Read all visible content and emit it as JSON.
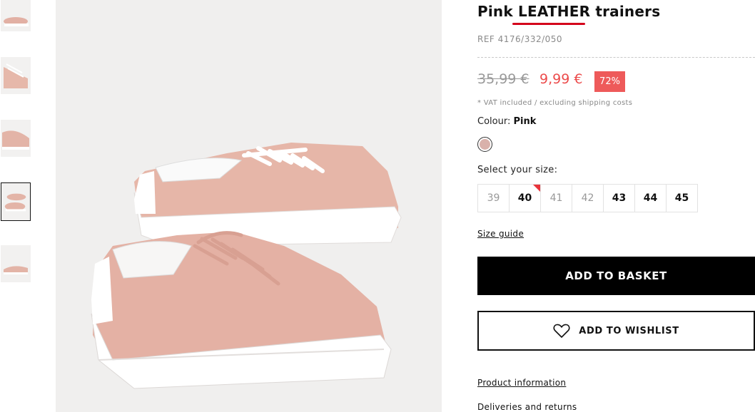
{
  "product": {
    "title": "Pink LEATHER trainers",
    "ref": "REF 4176/332/050",
    "old_price": "35,99 €",
    "new_price": "9,99 €",
    "discount": "72%",
    "vat_note": "* VAT included / excluding shipping costs",
    "colour_label": "Colour:",
    "colour_value": "Pink",
    "swatch_color": "#d9b1ab",
    "size_label": "Select your size:",
    "sizes": [
      {
        "label": "39",
        "available": false
      },
      {
        "label": "40",
        "available": true,
        "flagged": true
      },
      {
        "label": "41",
        "available": false
      },
      {
        "label": "42",
        "available": false
      },
      {
        "label": "43",
        "available": true
      },
      {
        "label": "44",
        "available": true
      },
      {
        "label": "45",
        "available": true
      }
    ],
    "size_guide": "Size guide",
    "add_to_basket": "ADD TO BASKET",
    "add_to_wishlist": "ADD TO WISHLIST",
    "product_information": "Product information",
    "deliveries_returns": "Deliveries and returns"
  },
  "gallery": {
    "thumbnail_count": 5,
    "active_thumbnail": 4
  },
  "colors": {
    "accent_red": "#ee5a5a",
    "underline_red": "#d4001b",
    "shoe_pink": "#e7b9ac"
  }
}
